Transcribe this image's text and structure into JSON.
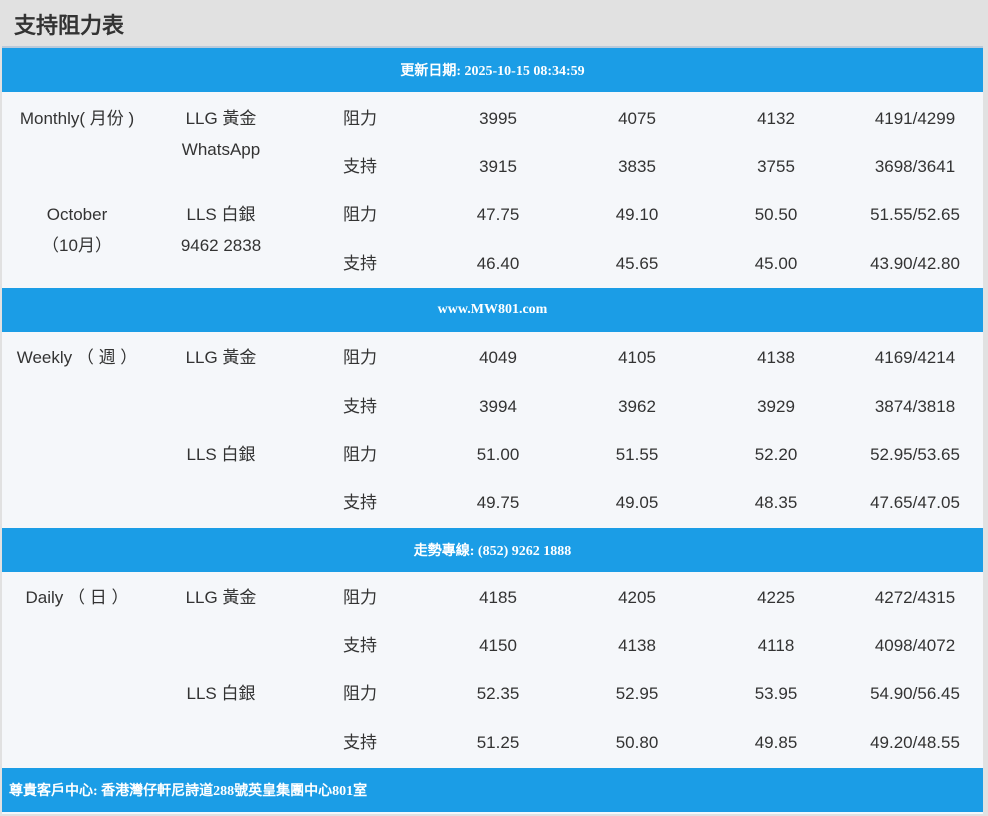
{
  "page_title": "支持阻力表",
  "colors": {
    "header_bar": "#1b9de6",
    "panel_bg": "#f5f7fa",
    "page_bg": "#e1e1e1"
  },
  "bars": {
    "updated": "更新日期: 2025-10-15 08:34:59",
    "website": "www.MW801.com",
    "hotline": "走勢專線: (852) 9262 1888",
    "address": "尊貴客戶中心: 香港灣仔軒尼詩道288號英皇集團中心801室"
  },
  "sections": {
    "monthly": {
      "period": [
        "Monthly( 月份 )",
        "",
        "October",
        "（10月）"
      ],
      "gold": {
        "label": "LLG 黃金",
        "sub": "WhatsApp",
        "resistance": {
          "label": "阻力",
          "values": [
            "3995",
            "4075",
            "4132",
            "4191/4299"
          ]
        },
        "support": {
          "label": "支持",
          "values": [
            "3915",
            "3835",
            "3755",
            "3698/3641"
          ]
        }
      },
      "silver": {
        "label": "LLS 白銀",
        "sub": "9462 2838",
        "resistance": {
          "label": "阻力",
          "values": [
            "47.75",
            "49.10",
            "50.50",
            "51.55/52.65"
          ]
        },
        "support": {
          "label": "支持",
          "values": [
            "46.40",
            "45.65",
            "45.00",
            "43.90/42.80"
          ]
        }
      }
    },
    "weekly": {
      "period": [
        "Weekly （ 週 ）"
      ],
      "gold": {
        "label": "LLG 黃金",
        "resistance": {
          "label": "阻力",
          "values": [
            "4049",
            "4105",
            "4138",
            "4169/4214"
          ]
        },
        "support": {
          "label": "支持",
          "values": [
            "3994",
            "3962",
            "3929",
            "3874/3818"
          ]
        }
      },
      "silver": {
        "label": "LLS 白銀",
        "resistance": {
          "label": "阻力",
          "values": [
            "51.00",
            "51.55",
            "52.20",
            "52.95/53.65"
          ]
        },
        "support": {
          "label": "支持",
          "values": [
            "49.75",
            "49.05",
            "48.35",
            "47.65/47.05"
          ]
        }
      }
    },
    "daily": {
      "period": [
        "Daily （ 日 ）"
      ],
      "gold": {
        "label": "LLG 黃金",
        "resistance": {
          "label": "阻力",
          "values": [
            "4185",
            "4205",
            "4225",
            "4272/4315"
          ]
        },
        "support": {
          "label": "支持",
          "values": [
            "4150",
            "4138",
            "4118",
            "4098/4072"
          ]
        }
      },
      "silver": {
        "label": "LLS 白銀",
        "resistance": {
          "label": "阻力",
          "values": [
            "52.35",
            "52.95",
            "53.95",
            "54.90/56.45"
          ]
        },
        "support": {
          "label": "支持",
          "values": [
            "51.25",
            "50.80",
            "49.85",
            "49.20/48.55"
          ]
        }
      }
    }
  }
}
